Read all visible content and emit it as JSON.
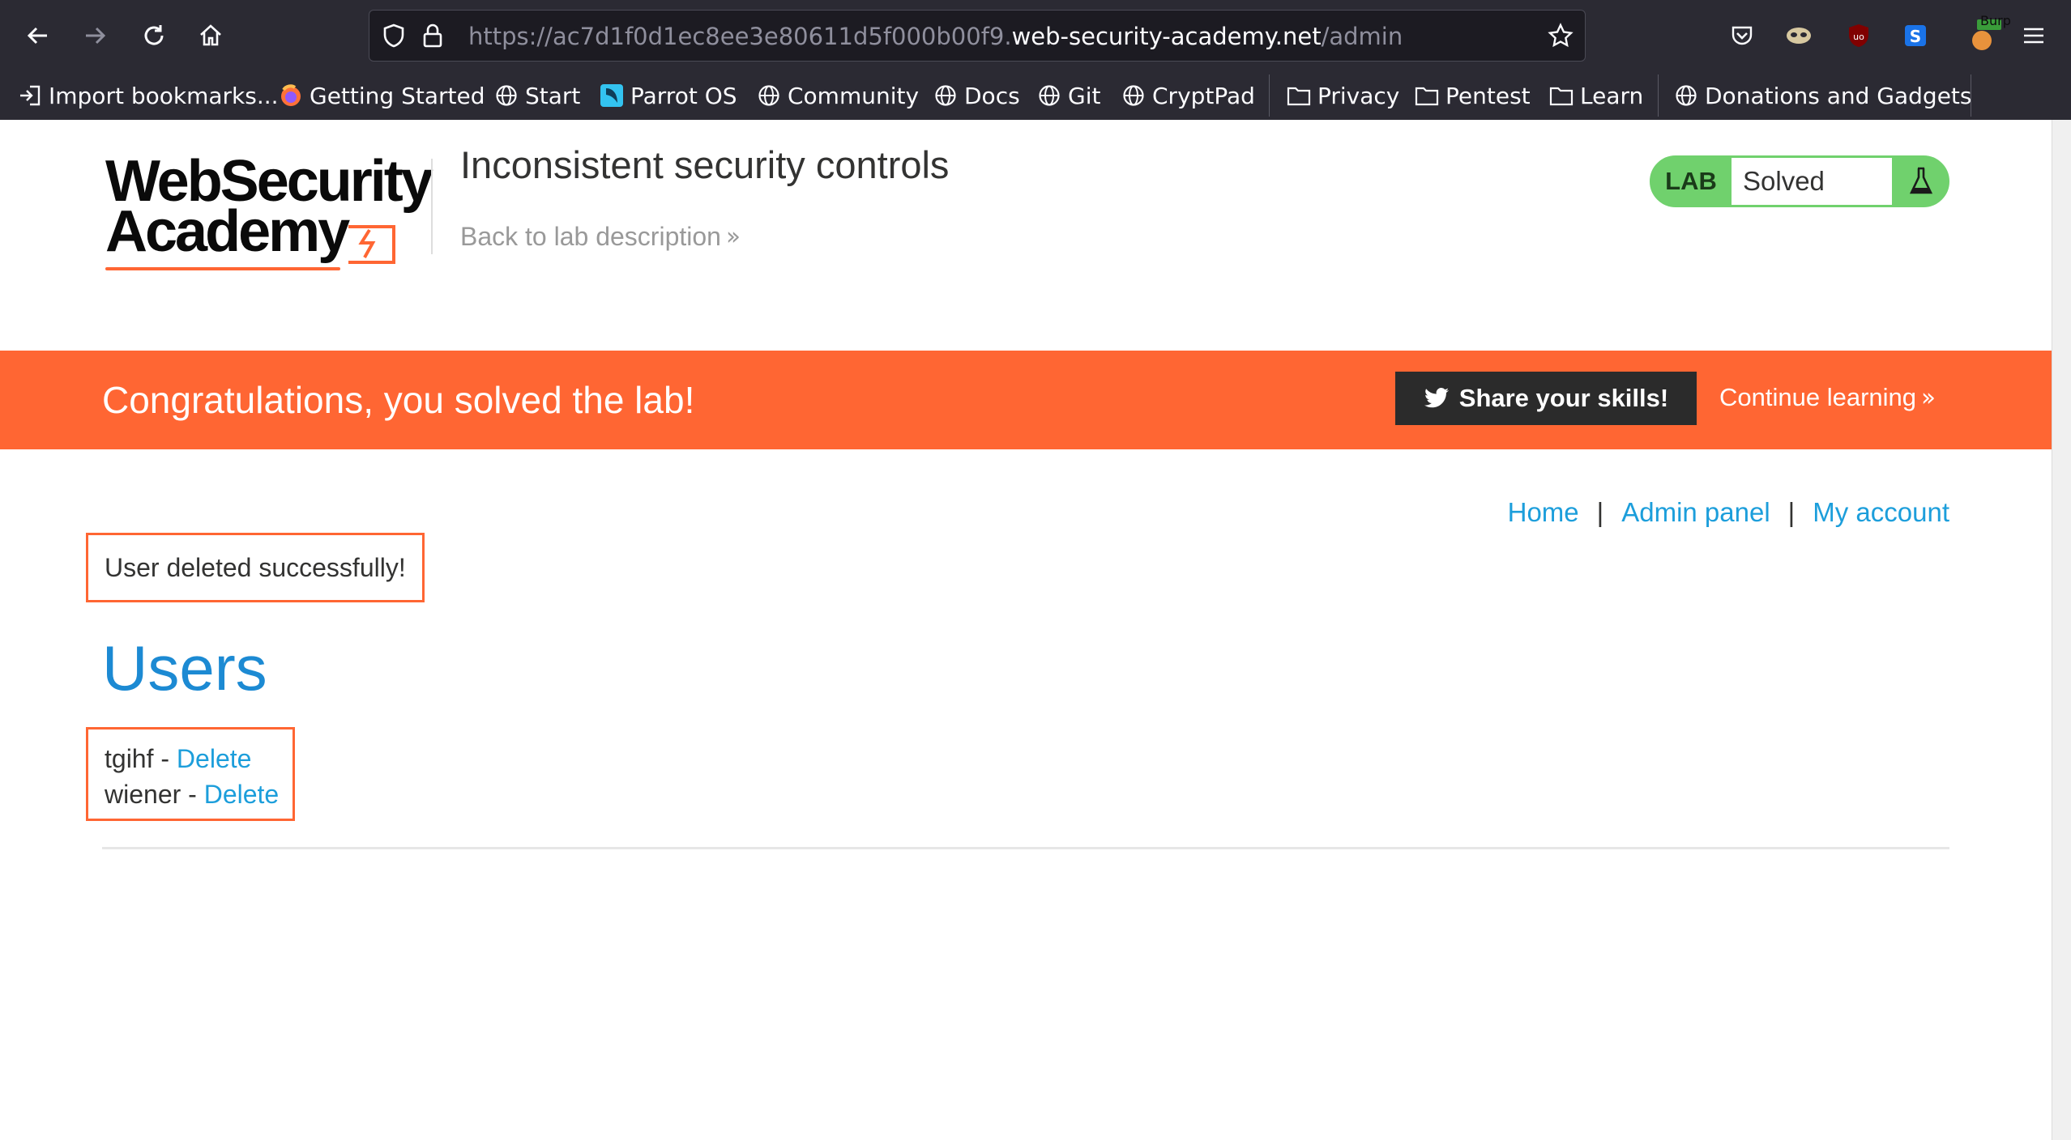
{
  "browser": {
    "url_prefix": "https://ac7d1f0d1ec8ee3e80611d5f000b00f9.",
    "url_host": "web-security-academy.net",
    "url_path": "/admin",
    "burp_badge": "Burp",
    "bookmarks": [
      {
        "label": "Import bookmarks...",
        "icon": "import-icon"
      },
      {
        "label": "Getting Started",
        "icon": "firefox-icon"
      },
      {
        "label": "Start",
        "icon": "globe-icon"
      },
      {
        "label": "Parrot OS",
        "icon": "parrot-icon"
      },
      {
        "label": "Community",
        "icon": "globe-icon"
      },
      {
        "label": "Docs",
        "icon": "globe-icon"
      },
      {
        "label": "Git",
        "icon": "globe-icon"
      },
      {
        "label": "CryptPad",
        "icon": "globe-icon"
      },
      {
        "label": "Privacy",
        "icon": "folder-icon"
      },
      {
        "label": "Pentest",
        "icon": "folder-icon"
      },
      {
        "label": "Learn",
        "icon": "folder-icon"
      },
      {
        "label": "Donations and Gadgets",
        "icon": "globe-icon"
      }
    ]
  },
  "header": {
    "logo_line1": "WebSecurity",
    "logo_line2": "Academy",
    "lab_title": "Inconsistent security controls",
    "back_link": "Back to lab description",
    "lab_badge_label": "LAB",
    "lab_status": "Solved"
  },
  "banner": {
    "message": "Congratulations, you solved the lab!",
    "share_button": "Share your skills!",
    "continue_link": "Continue learning"
  },
  "nav": {
    "home": "Home",
    "admin_panel": "Admin panel",
    "my_account": "My account",
    "separator": "|"
  },
  "main": {
    "notice": "User deleted successfully!",
    "heading": "Users",
    "users": [
      {
        "name": "tgihf",
        "sep": " - ",
        "action": "Delete"
      },
      {
        "name": "wiener",
        "sep": " - ",
        "action": "Delete"
      }
    ]
  },
  "colors": {
    "accent_orange": "#ff6633",
    "link_blue": "#1c9edb",
    "heading_blue": "#1c8ad3",
    "lab_green": "#70d16d",
    "chrome_dark": "#2b2a33"
  }
}
